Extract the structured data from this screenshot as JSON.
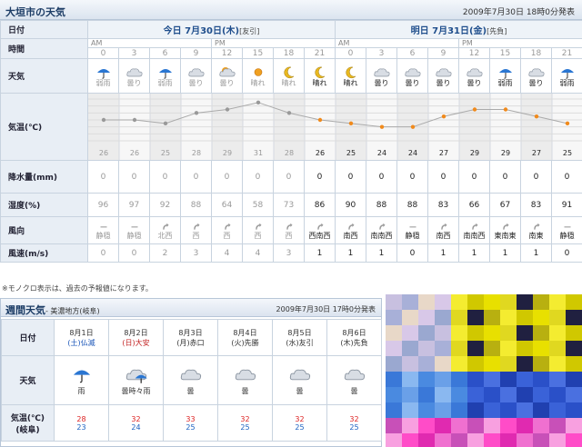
{
  "header": {
    "title": "大垣市の天気",
    "issued": "2009年7月30日 18時0分発表"
  },
  "labels": {
    "date": "日付",
    "time": "時間",
    "weather": "天気",
    "temp": "気温(℃)",
    "precip": "降水量(mm)",
    "humidity": "湿度(%)",
    "wind": "風向",
    "windspeed": "風速(m/s)"
  },
  "today": {
    "label": "今日 7月30日(木)",
    "rokuyo": "[友引]",
    "am": "AM",
    "pm": "PM"
  },
  "tomorrow": {
    "label": "明日 7月31日(金)",
    "rokuyo": "[先負]",
    "am": "AM",
    "pm": "PM"
  },
  "hours": [
    "0",
    "3",
    "6",
    "9",
    "12",
    "15",
    "18",
    "21",
    "0",
    "3",
    "6",
    "9",
    "12",
    "15",
    "18",
    "21"
  ],
  "weather": [
    {
      "icon": "umbrella-icon",
      "text": "弱雨"
    },
    {
      "icon": "cloud-icon",
      "text": "曇り"
    },
    {
      "icon": "umbrella-icon",
      "text": "弱雨"
    },
    {
      "icon": "cloud-icon",
      "text": "曇り"
    },
    {
      "icon": "sun-cloud-icon",
      "text": "曇り"
    },
    {
      "icon": "sun-icon",
      "text": "晴れ"
    },
    {
      "icon": "moon-icon",
      "text": "晴れ"
    },
    {
      "icon": "moon-icon",
      "text": "晴れ"
    },
    {
      "icon": "moon-icon",
      "text": "晴れ"
    },
    {
      "icon": "cloud-icon",
      "text": "曇り"
    },
    {
      "icon": "cloud-icon",
      "text": "曇り"
    },
    {
      "icon": "cloud-icon",
      "text": "曇り"
    },
    {
      "icon": "cloud-icon",
      "text": "曇り"
    },
    {
      "icon": "umbrella-icon",
      "text": "弱雨"
    },
    {
      "icon": "cloud-icon",
      "text": "曇り"
    },
    {
      "icon": "umbrella-icon",
      "text": "弱雨"
    }
  ],
  "chart_data": {
    "type": "line",
    "x": [
      "0",
      "3",
      "6",
      "9",
      "12",
      "15",
      "18",
      "21",
      "0",
      "3",
      "6",
      "9",
      "12",
      "15",
      "18",
      "21"
    ],
    "series": [
      {
        "values": [
          26,
          26,
          25,
          28,
          29,
          31,
          28,
          26,
          25,
          24,
          24,
          27,
          29,
          29,
          27,
          25
        ]
      }
    ],
    "yticks": [
      "32",
      "30",
      "28",
      "26",
      "24",
      "22",
      "20"
    ],
    "ylim": [
      20,
      32
    ]
  },
  "temps": [
    "26",
    "26",
    "25",
    "28",
    "29",
    "31",
    "28",
    "26",
    "25",
    "24",
    "24",
    "27",
    "29",
    "29",
    "27",
    "25"
  ],
  "precip": [
    "0",
    "0",
    "0",
    "0",
    "0",
    "0",
    "0",
    "0",
    "0",
    "0",
    "0",
    "0",
    "0",
    "0",
    "0",
    "0"
  ],
  "humidity": [
    "96",
    "97",
    "92",
    "88",
    "64",
    "58",
    "73",
    "86",
    "90",
    "88",
    "88",
    "83",
    "66",
    "67",
    "83",
    "91"
  ],
  "wind": [
    {
      "icon": "calm-icon",
      "text": "静穏"
    },
    {
      "icon": "calm-icon",
      "text": "静穏"
    },
    {
      "icon": "wind-arrow-icon",
      "text": "北西"
    },
    {
      "icon": "wind-arrow-icon",
      "text": "西"
    },
    {
      "icon": "wind-arrow-icon",
      "text": "西"
    },
    {
      "icon": "wind-arrow-icon",
      "text": "西"
    },
    {
      "icon": "wind-arrow-icon",
      "text": "西"
    },
    {
      "icon": "wind-arrow-icon",
      "text": "西南西"
    },
    {
      "icon": "wind-arrow-icon",
      "text": "南西"
    },
    {
      "icon": "wind-arrow-icon",
      "text": "南南西"
    },
    {
      "icon": "calm-icon",
      "text": "静穏"
    },
    {
      "icon": "wind-arrow-icon",
      "text": "南西"
    },
    {
      "icon": "wind-arrow-icon",
      "text": "南南西"
    },
    {
      "icon": "wind-arrow-icon",
      "text": "東南東"
    },
    {
      "icon": "wind-arrow-icon",
      "text": "南東"
    },
    {
      "icon": "calm-icon",
      "text": "静穏"
    }
  ],
  "windspeed": [
    "0",
    "0",
    "2",
    "3",
    "4",
    "4",
    "3",
    "1",
    "1",
    "1",
    "0",
    "1",
    "1",
    "1",
    "1",
    "0"
  ],
  "note": "※モノクロ表示は、過去の予報値になります。",
  "weekly": {
    "title": "週間天気",
    "subtitle": "- 美濃地方(岐阜)",
    "issued": "2009年7月30日 17時0分発表",
    "labels": {
      "date": "日付",
      "weather": "天気",
      "temp": "気温(℃)",
      "place": "(岐阜)"
    },
    "days": [
      {
        "date": "8月1日",
        "dow": "(土)仏滅",
        "cls": "sat",
        "icon": "umbrella-icon",
        "text": "雨",
        "hi": "28",
        "lo": "23"
      },
      {
        "date": "8月2日",
        "dow": "(日)大安",
        "cls": "sun",
        "icon": "cloud-umbrella-icon",
        "text": "曇時々雨",
        "hi": "32",
        "lo": "24"
      },
      {
        "date": "8月3日",
        "dow": "(月)赤口",
        "cls": "",
        "icon": "cloud-icon",
        "text": "曇",
        "hi": "33",
        "lo": "25"
      },
      {
        "date": "8月4日",
        "dow": "(火)先勝",
        "cls": "",
        "icon": "cloud-icon",
        "text": "曇",
        "hi": "32",
        "lo": "25"
      },
      {
        "date": "8月5日",
        "dow": "(水)友引",
        "cls": "",
        "icon": "cloud-icon",
        "text": "曇",
        "hi": "32",
        "lo": "25"
      },
      {
        "date": "8月6日",
        "dow": "(木)先負",
        "cls": "",
        "icon": "cloud-icon",
        "text": "曇",
        "hi": "32",
        "lo": "25"
      }
    ]
  },
  "colors": {
    "accent": "#1f4e8c",
    "header_bg": "#dbe4ef",
    "grid": "#c8d3df",
    "orange": "#f08a1c",
    "gray_line": "#aaaaaa"
  }
}
